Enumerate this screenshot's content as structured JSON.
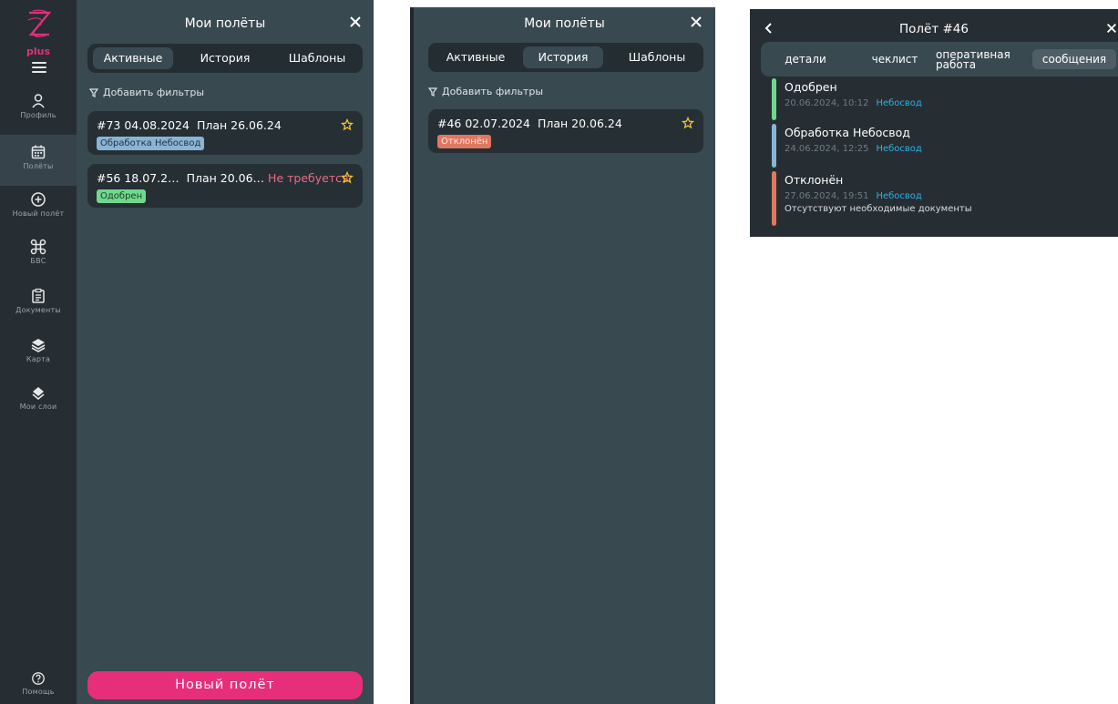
{
  "sidebar": {
    "logo_text": "plus",
    "items": [
      {
        "label": "Профиль",
        "icon": "person-icon"
      },
      {
        "label": "Полёты",
        "icon": "calendar-icon"
      },
      {
        "label": "Новый полёт",
        "icon": "plus-circle-icon"
      },
      {
        "label": "БВС",
        "icon": "command-icon"
      },
      {
        "label": "Документы",
        "icon": "clipboard-icon"
      },
      {
        "label": "Карта",
        "icon": "layers-icon"
      },
      {
        "label": "Мои слои",
        "icon": "layers-diamond-icon"
      }
    ],
    "help": {
      "label": "Помощь",
      "icon": "help-circle-icon"
    }
  },
  "panel_active": {
    "title": "Мои полёты",
    "tabs": [
      "Активные",
      "История",
      "Шаблоны"
    ],
    "active_tab": "Активные",
    "filters_label": "Добавить фильтры",
    "cards": [
      {
        "id_date": "#73  04.08.2024",
        "plan": "План 26.06.24",
        "requirement": "",
        "status": "Обработка Небосвод",
        "status_color": "#8ab4d5"
      },
      {
        "id_date": "#56  18.07.2…",
        "plan": "План 20.06…",
        "requirement": "Не требуется",
        "status": "Одобрен",
        "status_color": "#6fd88d"
      }
    ],
    "new_flight_button": "Новый полёт"
  },
  "panel_history": {
    "title": "Мои полёты",
    "tabs": [
      "Активные",
      "История",
      "Шаблоны"
    ],
    "active_tab": "История",
    "filters_label": "Добавить фильтры",
    "cards": [
      {
        "id_date": "#46  02.07.2024",
        "plan": "План 20.06.24",
        "status": "Отклонён",
        "status_color": "#e07760"
      }
    ]
  },
  "flight_detail": {
    "title": "Полёт #46",
    "tabs": [
      "детали",
      "чеклист",
      "оперативная работа",
      "сообщения"
    ],
    "active_tab": "сообщения",
    "events": [
      {
        "name": "Одобрен",
        "datetime": "20.06.2024, 10:12",
        "source": "Небосвод",
        "note": "",
        "color": "#6fd88d"
      },
      {
        "name": "Обработка Небосвод",
        "datetime": "24.06.2024, 12:25",
        "source": "Небосвод",
        "note": "",
        "color": "#8ab4d5"
      },
      {
        "name": "Отклонён",
        "datetime": "27.06.2024, 19:51",
        "source": "Небосвод",
        "note": "Отсутствуют необходимые документы",
        "color": "#e07760"
      }
    ]
  },
  "colors": {
    "accent": "#e72e7a",
    "star": "#f2c230",
    "panel_bg": "#384950",
    "sidebar_bg": "#262e33",
    "link": "#2fb1e6"
  }
}
